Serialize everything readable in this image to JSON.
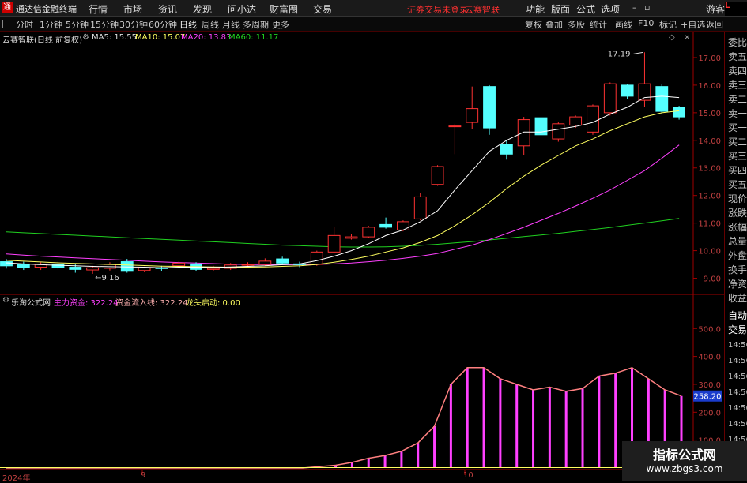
{
  "titlebar": {
    "app_name": "通达信金融终端",
    "menus": [
      "行情",
      "市场",
      "资讯",
      "发现",
      "问小达",
      "财富圈",
      "交易"
    ],
    "notice": "证券交易未登录",
    "stock": "云赛智联",
    "right_menus": [
      "功能",
      "版面",
      "公式",
      "选项"
    ],
    "guest": "游客"
  },
  "toolbar": {
    "periods": [
      "分时",
      "1分钟",
      "5分钟",
      "15分钟",
      "30分钟",
      "60分钟",
      "日线",
      "周线",
      "月线",
      "多周期",
      "更多"
    ],
    "active_period": "日线",
    "right_items": [
      "复权",
      "叠加",
      "多股",
      "统计",
      "画线",
      "F10",
      "标记",
      "+自选",
      "返回"
    ]
  },
  "legend_top": {
    "name": "云赛智联(日线 前复权)",
    "ma5": "MA5: 15.55",
    "ma10": "MA10: 15.07",
    "ma20": "MA20: 13.83",
    "ma60": "MA60: 11.17"
  },
  "legend_bot": {
    "name": "乐淘公式网",
    "main_fund": "主力资金: 322.24",
    "flow_line": "资金流入线: 322.24",
    "dragon": "龙头启动: 0.00"
  },
  "right_panel": [
    "委比",
    "卖五",
    "卖四",
    "卖三",
    "卖二",
    "卖一",
    "买一",
    "买二",
    "买三",
    "买四",
    "买五",
    "现价",
    "涨跌",
    "涨幅",
    "总量",
    "外盘",
    "换手",
    "净资",
    "收益",
    "自动",
    "交易",
    "14:56",
    "14:56",
    "14:56",
    "14:56",
    "14:56",
    "14:56",
    "14:56"
  ],
  "annotations": {
    "high": "17.19",
    "low": "9.16",
    "current_value": "258.20"
  },
  "x_labels": [
    "2024年",
    "9",
    "10"
  ],
  "watermark": {
    "line1": "指标公式网",
    "line2": "www.zbgs3.com"
  },
  "colors": {
    "up": "#ff3232",
    "down": "#54ffff",
    "ma5": "#ffffff",
    "ma10": "#ffff60",
    "ma20": "#ff40ff",
    "ma60": "#20d020",
    "bar": "#ff40ff",
    "flowline": "#ff8080"
  },
  "chart_data": [
    {
      "type": "candlestick",
      "y_ticks": [
        17.0,
        16.0,
        15.0,
        14.0,
        13.0,
        12.0,
        11.0,
        10.0,
        9.0
      ],
      "ylim": [
        8.5,
        17.6
      ],
      "candles": [
        {
          "o": 9.6,
          "c": 9.45,
          "h": 9.7,
          "l": 9.35
        },
        {
          "o": 9.5,
          "c": 9.4,
          "h": 9.6,
          "l": 9.3
        },
        {
          "o": 9.4,
          "c": 9.5,
          "h": 9.58,
          "l": 9.3
        },
        {
          "o": 9.5,
          "c": 9.4,
          "h": 9.62,
          "l": 9.32
        },
        {
          "o": 9.4,
          "c": 9.32,
          "h": 9.5,
          "l": 9.2
        },
        {
          "o": 9.3,
          "c": 9.38,
          "h": 9.45,
          "l": 9.16
        },
        {
          "o": 9.36,
          "c": 9.5,
          "h": 9.58,
          "l": 9.28
        },
        {
          "o": 9.6,
          "c": 9.25,
          "h": 9.7,
          "l": 9.2
        },
        {
          "o": 9.28,
          "c": 9.38,
          "h": 9.42,
          "l": 9.22
        },
        {
          "o": 9.38,
          "c": 9.35,
          "h": 9.45,
          "l": 9.26
        },
        {
          "o": 9.45,
          "c": 9.55,
          "h": 9.6,
          "l": 9.4
        },
        {
          "o": 9.52,
          "c": 9.32,
          "h": 9.58,
          "l": 9.26
        },
        {
          "o": 9.32,
          "c": 9.36,
          "h": 9.45,
          "l": 9.25
        },
        {
          "o": 9.36,
          "c": 9.48,
          "h": 9.55,
          "l": 9.3
        },
        {
          "o": 9.48,
          "c": 9.5,
          "h": 9.58,
          "l": 9.42
        },
        {
          "o": 9.5,
          "c": 9.62,
          "h": 9.72,
          "l": 9.45
        },
        {
          "o": 9.7,
          "c": 9.55,
          "h": 9.78,
          "l": 9.48
        },
        {
          "o": 9.52,
          "c": 9.5,
          "h": 9.6,
          "l": 9.4
        },
        {
          "o": 9.5,
          "c": 9.95,
          "h": 10.0,
          "l": 9.45
        },
        {
          "o": 9.95,
          "c": 10.55,
          "h": 10.85,
          "l": 9.9
        },
        {
          "o": 10.45,
          "c": 10.5,
          "h": 10.6,
          "l": 10.4
        },
        {
          "o": 10.5,
          "c": 10.85,
          "h": 10.9,
          "l": 10.45
        },
        {
          "o": 10.95,
          "c": 10.85,
          "h": 11.2,
          "l": 10.8
        },
        {
          "o": 10.75,
          "c": 11.05,
          "h": 11.1,
          "l": 10.7
        },
        {
          "o": 11.15,
          "c": 11.95,
          "h": 12.1,
          "l": 11.1
        },
        {
          "o": 12.4,
          "c": 13.05,
          "h": 13.1,
          "l": 12.35
        },
        {
          "o": 14.5,
          "c": 14.52,
          "h": 14.6,
          "l": 13.5
        },
        {
          "o": 14.65,
          "c": 15.15,
          "h": 15.95,
          "l": 14.4
        },
        {
          "o": 15.95,
          "c": 14.45,
          "h": 16.0,
          "l": 14.2
        },
        {
          "o": 13.85,
          "c": 13.5,
          "h": 14.0,
          "l": 13.3
        },
        {
          "o": 13.8,
          "c": 14.75,
          "h": 14.85,
          "l": 13.45
        },
        {
          "o": 14.82,
          "c": 14.2,
          "h": 14.9,
          "l": 14.1
        },
        {
          "o": 14.05,
          "c": 14.6,
          "h": 14.65,
          "l": 13.95
        },
        {
          "o": 14.55,
          "c": 14.85,
          "h": 14.9,
          "l": 14.45
        },
        {
          "o": 14.3,
          "c": 15.25,
          "h": 15.3,
          "l": 14.2
        },
        {
          "o": 15.0,
          "c": 16.05,
          "h": 16.1,
          "l": 14.9
        },
        {
          "o": 16.0,
          "c": 15.6,
          "h": 16.05,
          "l": 15.5
        },
        {
          "o": 15.45,
          "c": 16.05,
          "h": 17.19,
          "l": 15.2
        },
        {
          "o": 15.95,
          "c": 15.05,
          "h": 16.05,
          "l": 14.95
        },
        {
          "o": 15.2,
          "c": 14.85,
          "h": 15.25,
          "l": 14.75
        }
      ],
      "ma5": [
        9.56,
        9.52,
        9.49,
        9.47,
        9.45,
        9.43,
        9.42,
        9.41,
        9.4,
        9.38,
        9.4,
        9.4,
        9.39,
        9.41,
        9.43,
        9.45,
        9.49,
        9.52,
        9.64,
        9.8,
        10.0,
        10.25,
        10.55,
        10.75,
        11.05,
        11.45,
        12.2,
        12.9,
        13.6,
        14.0,
        14.3,
        14.3,
        14.4,
        14.5,
        14.65,
        14.95,
        15.2,
        15.55,
        15.6,
        15.55
      ],
      "ma10": [
        9.65,
        9.62,
        9.59,
        9.56,
        9.54,
        9.52,
        9.5,
        9.48,
        9.46,
        9.44,
        9.43,
        9.42,
        9.41,
        9.4,
        9.4,
        9.41,
        9.43,
        9.45,
        9.5,
        9.58,
        9.68,
        9.8,
        9.95,
        10.1,
        10.3,
        10.55,
        10.9,
        11.3,
        11.75,
        12.25,
        12.7,
        13.1,
        13.45,
        13.8,
        14.05,
        14.35,
        14.6,
        14.85,
        15.0,
        15.07
      ],
      "ma20": [
        9.88,
        9.84,
        9.8,
        9.77,
        9.74,
        9.71,
        9.68,
        9.65,
        9.62,
        9.59,
        9.57,
        9.55,
        9.53,
        9.51,
        9.5,
        9.49,
        9.49,
        9.49,
        9.5,
        9.52,
        9.55,
        9.6,
        9.65,
        9.72,
        9.8,
        9.9,
        10.05,
        10.2,
        10.4,
        10.62,
        10.85,
        11.1,
        11.35,
        11.62,
        11.9,
        12.2,
        12.55,
        12.9,
        13.35,
        13.83
      ],
      "ma60": [
        10.68,
        10.65,
        10.62,
        10.59,
        10.56,
        10.53,
        10.5,
        10.47,
        10.44,
        10.41,
        10.38,
        10.35,
        10.32,
        10.29,
        10.26,
        10.23,
        10.2,
        10.18,
        10.16,
        10.14,
        10.13,
        10.13,
        10.14,
        10.16,
        10.19,
        10.23,
        10.28,
        10.33,
        10.39,
        10.45,
        10.51,
        10.57,
        10.63,
        10.7,
        10.77,
        10.84,
        10.92,
        11.0,
        11.08,
        11.17
      ]
    },
    {
      "type": "bar",
      "series_label": "主力资金",
      "y_ticks": [
        500.0,
        400.0,
        300.0,
        200.0,
        100.0
      ],
      "ylim": [
        0,
        580
      ],
      "values": [
        0,
        0,
        0,
        0,
        0,
        0,
        0,
        0,
        0,
        0,
        0,
        0,
        0,
        0,
        0,
        0,
        0,
        0,
        0,
        5,
        10,
        20,
        35,
        45,
        60,
        90,
        150,
        300,
        360,
        360,
        320,
        300,
        280,
        290,
        275,
        285,
        330,
        340,
        360,
        320,
        280,
        258.2
      ],
      "flow_line": [
        0,
        0,
        0,
        0,
        0,
        0,
        0,
        0,
        0,
        0,
        0,
        0,
        0,
        0,
        0,
        0,
        0,
        0,
        0,
        5,
        10,
        20,
        35,
        45,
        60,
        90,
        150,
        300,
        360,
        360,
        320,
        300,
        280,
        290,
        275,
        285,
        330,
        340,
        360,
        320,
        280,
        258.2
      ]
    }
  ]
}
